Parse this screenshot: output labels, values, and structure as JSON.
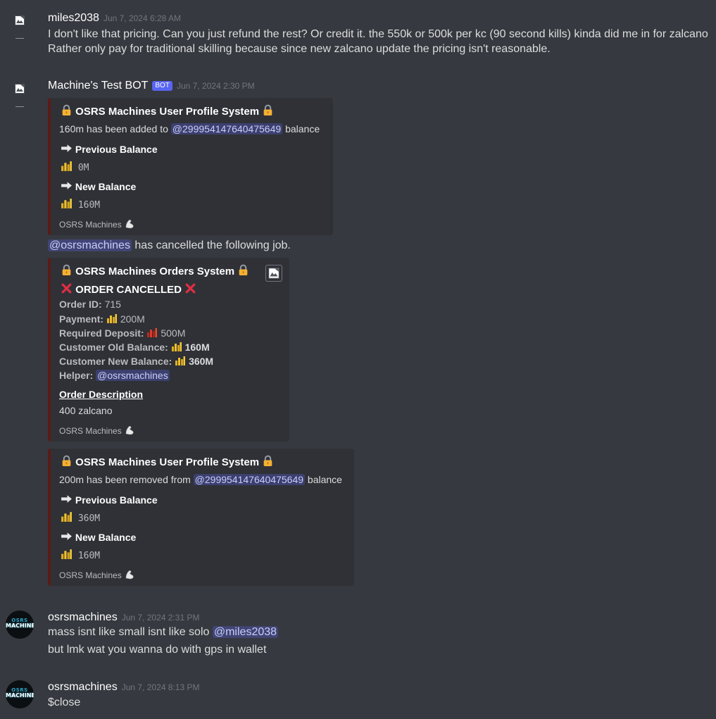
{
  "messages": {
    "m1": {
      "username": "miles2038",
      "timestamp": "Jun 7, 2024 6:28 AM",
      "line1": "I don't like that pricing. Can you just refund the rest? Or credit it. the 550k or 500k per kc (90 second kills) kinda did me in for zalcano",
      "line2": "Rather only pay for traditional skilling because since new zalcano update the pricing isn't reasonable."
    },
    "m2": {
      "username": "Machine's Test BOT",
      "bot_tag": "BOT",
      "timestamp": "Jun 7, 2024 2:30 PM",
      "embed1": {
        "title": "OSRS Machines User Profile System",
        "desc_pre": "160m has been added to",
        "desc_mention": "@299954147640475649",
        "desc_post": "balance",
        "field1_name": "Previous Balance",
        "field1_value": "0M",
        "field2_name": "New Balance",
        "field2_value": "160M",
        "footer": "OSRS Machines"
      },
      "text_mention": "@osrsmachines",
      "text_rest": " has cancelled the following job.",
      "embed2": {
        "title": "OSRS Machines Orders System",
        "subtitle": "ORDER CANCELLED",
        "order_id_label": "Order ID:",
        "order_id": "715",
        "payment_label": "Payment:",
        "payment": "200M",
        "deposit_label": "Required Deposit:",
        "deposit": "500M",
        "old_balance_label": "Customer Old Balance:",
        "old_balance": "160M",
        "new_balance_label": "Customer New Balance:",
        "new_balance": "360M",
        "helper_label": "Helper:",
        "helper": "@osrsmachines",
        "description_heading": "Order Description",
        "description": "400 zalcano",
        "footer": "OSRS Machines"
      },
      "embed3": {
        "title": "OSRS Machines User Profile System",
        "desc_pre": "200m has been removed from",
        "desc_mention": "@299954147640475649",
        "desc_post": "balance",
        "field1_name": "Previous Balance",
        "field1_value": "360M",
        "field2_name": "New Balance",
        "field2_value": "160M",
        "footer": "OSRS Machines"
      }
    },
    "m3": {
      "username": "osrsmachines",
      "timestamp": "Jun 7, 2024 2:31 PM",
      "line1_pre": "mass isnt like small isnt like solo",
      "line1_mention": "@miles2038",
      "line2": "but lmk wat you wanna do with gps in wallet"
    },
    "m4": {
      "username": "osrsmachines",
      "timestamp": "Jun 7, 2024 8:13 PM",
      "line1": "$close"
    }
  },
  "avatar_logo": {
    "top": "OSRS",
    "bottom": "MACHINES"
  },
  "colors": {
    "background": "#36393f",
    "embed_bg": "#2f3136",
    "embed_border": "#5d1a16",
    "mention_text": "#c9cdfb",
    "bot_tag": "#5865f2"
  },
  "icons": [
    "broken-image-icon",
    "lock-icon",
    "arrow-right-icon",
    "coins-icon",
    "red-coins-icon",
    "flexed-arm-icon",
    "cross-mark-icon"
  ]
}
